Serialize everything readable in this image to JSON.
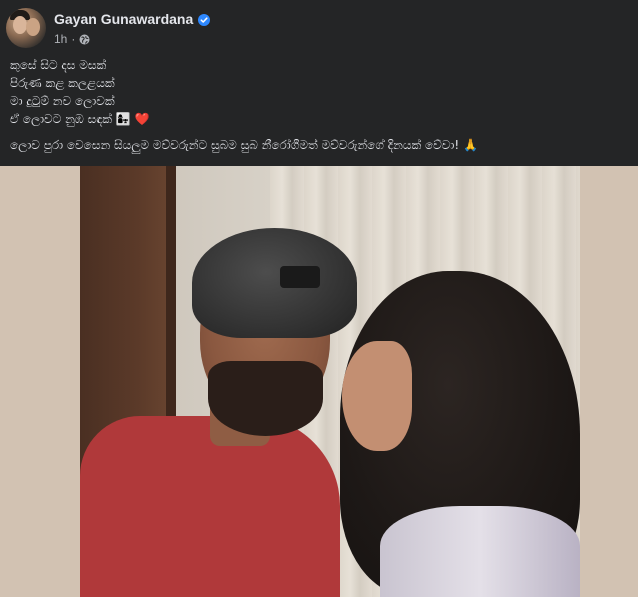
{
  "post": {
    "author": {
      "name": "Gayan Gunawardana",
      "verified": true,
      "avatar_icon": "profile-avatar"
    },
    "timestamp": "1h",
    "separator": "·",
    "audience_icon": "globe-icon",
    "text_lines": [
      "කුසේ සිට දස මසක්",
      "පිරුණ කළ කලළයක්",
      "මා දුටුම් නව ලොවක්",
      "ඒ ලොවට නුඹ සඳක් 👩‍👧 ❤️"
    ],
    "wish_line": "ලොව පුරා වෙසෙන සියලුම මව්වරුන්ට සුබම සුබ නීරෝගීමත් මව්වරුන්ගේ දිනයක් වේවා! 🙏",
    "photo": {
      "description_icon": "post-photo"
    }
  },
  "colors": {
    "background": "#242526",
    "text_primary": "#e4e6eb",
    "text_secondary": "#b0b3b8",
    "verified_badge": "#2d88ff"
  }
}
